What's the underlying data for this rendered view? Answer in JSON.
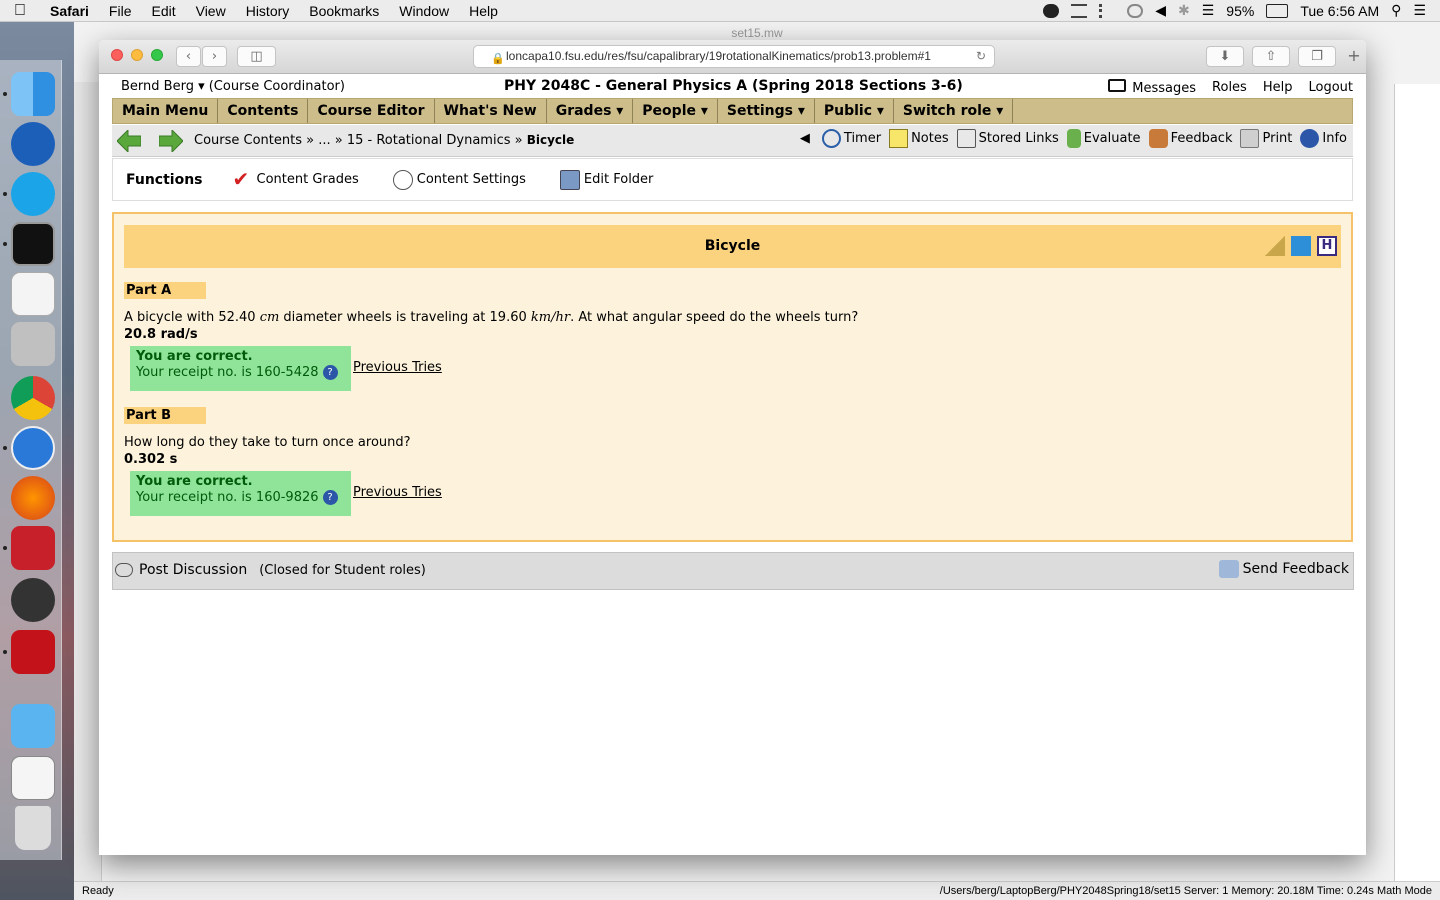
{
  "menubar": {
    "app": "Safari",
    "items": [
      "File",
      "Edit",
      "View",
      "History",
      "Bookmarks",
      "Window",
      "Help"
    ],
    "battery": "95%",
    "clock": "Tue 6:56 AM"
  },
  "background_window": {
    "title": "set15.mw",
    "status_left": "Ready",
    "status_right": "/Users/berg/LaptopBerg/PHY2048Spring18/set15   Server: 1   Memory: 20.18M   Time: 0.24s   Math Mode"
  },
  "browser": {
    "url": "loncapa10.fsu.edu/res/fsu/capalibrary/19rotationalKinematics/prob13.problem#1"
  },
  "userbar": {
    "user": "Bernd Berg ▾  (Course Coordinator)",
    "course": "PHY 2048C - General Physics A (Spring 2018 Sections 3-6)",
    "links": [
      "Messages",
      "Roles",
      "Help",
      "Logout"
    ]
  },
  "mainmenu": [
    "Main Menu",
    "Contents",
    "Course Editor",
    "What's New",
    "Grades ▾",
    "People ▾",
    "Settings ▾",
    "Public ▾",
    "Switch role ▾"
  ],
  "breadcrumbs": {
    "trail": "Course Contents » ... » 15 - Rotational Dynamics » ",
    "current": "Bicycle"
  },
  "navtools": {
    "timer": "Timer",
    "notes": "Notes",
    "stored_links": "Stored Links",
    "evaluate": "Evaluate",
    "feedback": "Feedback",
    "print": "Print",
    "info": "Info"
  },
  "functions": {
    "title": "Functions",
    "content_grades": "Content Grades",
    "content_settings": "Content Settings",
    "edit_folder": "Edit Folder"
  },
  "problem": {
    "title": "Bicycle",
    "part_a": {
      "label": "Part A",
      "q1": "A bicycle with 52.40 ",
      "unit1": "cm",
      "q2": " diameter wheels is traveling at 19.60 ",
      "unit2": "km/hr",
      "q3": ". At what angular speed do the wheels turn?",
      "answer": "20.8 rad/s",
      "status": "You are correct.",
      "receipt": "Your receipt no. is 160-5428",
      "prev": "Previous Tries"
    },
    "part_b": {
      "label": "Part B",
      "question": "How long do they take to turn once around?",
      "answer": "0.302 s",
      "status": "You are correct.",
      "receipt": "Your receipt no. is 160-9826",
      "prev": "Previous Tries"
    }
  },
  "discussion": {
    "post": "Post Discussion",
    "closed": "(Closed for Student roles)",
    "send": "Send Feedback"
  },
  "colors": {
    "menu_bg": "#cdbd8a",
    "problem_border": "#f5c26a",
    "title_bg": "#fbd27e",
    "correct_bg": "#8fe49a"
  }
}
